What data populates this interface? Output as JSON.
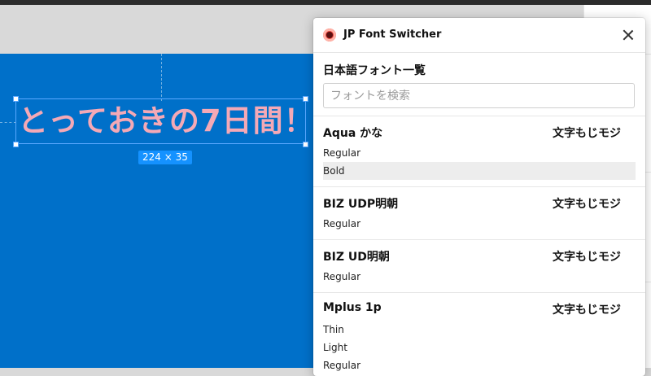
{
  "canvas": {
    "text": "とっておきの7日間！",
    "size_badge": "224 × 35"
  },
  "plugin": {
    "title": "JP Font Switcher",
    "section_title": "日本語フォント一覧",
    "search_placeholder": "フォントを検索",
    "groups": [
      {
        "name": "Aqua かな",
        "sample": "文字もじモジ",
        "styles": [
          "Regular",
          "Bold"
        ]
      },
      {
        "name": "BIZ UDP明朝",
        "sample": "文字もじモジ",
        "styles": [
          "Regular"
        ]
      },
      {
        "name": "BIZ UD明朝",
        "sample": "文字もじモジ",
        "styles": [
          "Regular"
        ]
      },
      {
        "name": "Mplus 1p",
        "sample": "文字もじモジ",
        "styles": [
          "Thin",
          "Light",
          "Regular"
        ]
      }
    ]
  },
  "colors": {
    "canvas_blue": "#0070c9",
    "canvas_text": "#f4a9b6",
    "selection": "#1592ff"
  }
}
